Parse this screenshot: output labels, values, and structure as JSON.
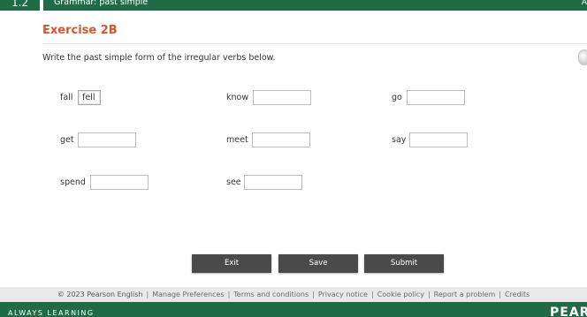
{
  "header": {
    "unit_number": "1.2",
    "title": "Grammar: past simple",
    "right_edge_text": "A"
  },
  "exercise": {
    "heading": "Exercise 2B",
    "instruction": "Write the past simple form of the irregular verbs below."
  },
  "verbs": [
    {
      "label": "fall",
      "value": "fell"
    },
    {
      "label": "know",
      "value": ""
    },
    {
      "label": "go",
      "value": ""
    },
    {
      "label": "get",
      "value": ""
    },
    {
      "label": "meet",
      "value": ""
    },
    {
      "label": "say",
      "value": ""
    },
    {
      "label": "spend",
      "value": ""
    },
    {
      "label": "see",
      "value": ""
    }
  ],
  "buttons": {
    "exit": "Exit",
    "save": "Save",
    "submit": "Submit"
  },
  "footer": {
    "copyright": "© 2023 Pearson English",
    "links": [
      "Manage Preferences",
      "Terms and conditions",
      "Privacy notice",
      "Cookie policy",
      "Report a problem",
      "Credits"
    ]
  },
  "bottom": {
    "tagline": "ALWAYS LEARNING",
    "brand": "PEARSON"
  },
  "colors": {
    "brand_green": "#1e6b45",
    "heading_orange": "#d8552b",
    "button_gray": "#4a4a4a"
  }
}
